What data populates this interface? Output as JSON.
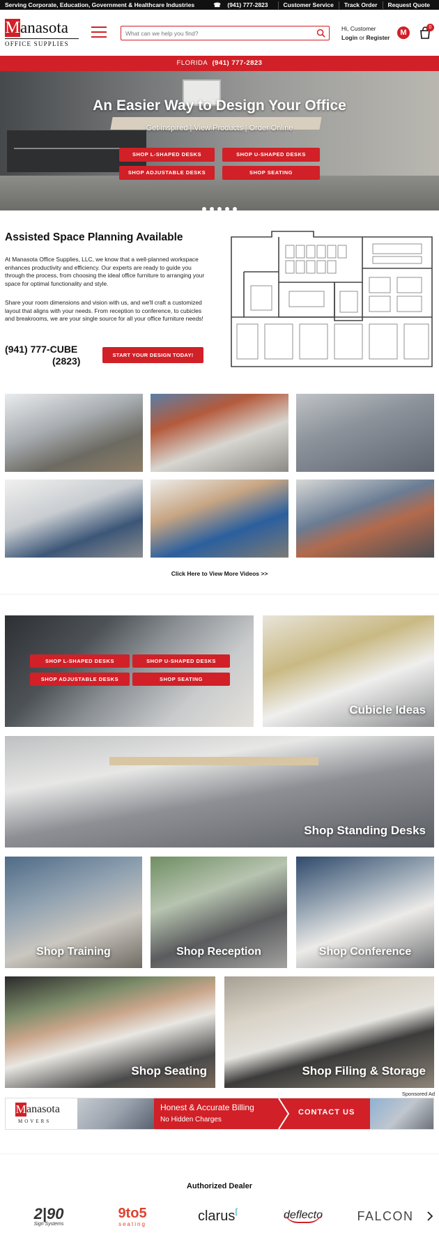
{
  "topbar": {
    "serving": "Serving Corporate, Education, Government & Healthcare Industries",
    "phone": "(941) 777-2823",
    "links": [
      "Customer Service",
      "Track Order",
      "Request Quote"
    ]
  },
  "header": {
    "logo_letter": "M",
    "logo_name": "anasota",
    "logo_sub": "OFFICE SUPPLIES",
    "search_placeholder": "What can we help you find?",
    "greeting": "Hi, Customer",
    "login": "Login",
    "or": "or",
    "register": "Register",
    "wishlist_letter": "M",
    "cart_count": "0"
  },
  "redbar": {
    "state": "FLORIDA",
    "phone": "(941) 777-2823"
  },
  "hero": {
    "title": "An Easier Way to Design Your Office",
    "tagline": "Get Inspired | View Products | Order Online",
    "buttons": [
      "SHOP L-SHAPED DESKS",
      "SHOP U-SHAPED DESKS",
      "SHOP ADJUSTABLE DESKS",
      "SHOP SEATING"
    ],
    "slides": 5
  },
  "planning": {
    "title": "Assisted Space Planning Available",
    "para1": "At Manasota Office Supplies, LLC, we know that a well-planned workspace enhances productivity and efficiency. Our experts are ready to guide you through the process, from choosing the ideal office furniture to arranging your space for optimal functionality and style.",
    "para2": "Share your room dimensions and vision with us, and we'll craft a customized layout that aligns with your needs. From reception to conference, to cubicles and breakrooms, we are your single source for all your office furniture needs!",
    "phone_line1": "(941) 777-CUBE",
    "phone_line2": "(2823)",
    "cta": "START YOUR DESIGN TODAY!"
  },
  "videos": {
    "more_link": "Click Here to View More Videos >>"
  },
  "categories": {
    "feature_buttons": [
      "SHOP L-SHAPED DESKS",
      "SHOP U-SHAPED DESKS",
      "SHOP ADJUSTABLE DESKS",
      "SHOP SEATING"
    ],
    "cubicle": "Cubicle Ideas",
    "standing": "Shop Standing Desks",
    "training": "Shop Training",
    "reception": "Shop Reception",
    "conference": "Shop Conference",
    "seating": "Shop Seating",
    "filing": "Shop Filing & Storage"
  },
  "ad": {
    "sponsored": "Sponsored Ad",
    "movers_name": "anasota",
    "movers_sub": "MOVERS",
    "line1": "Honest & Accurate Billing",
    "line2": "No Hidden Charges",
    "cta": "CONTACT US"
  },
  "dealers": {
    "title": "Authorized Dealer",
    "brands": [
      "2|90",
      "Sign Systems",
      "9to5",
      "seating",
      "clarus",
      "deflecto",
      "FALCON"
    ]
  },
  "colors": {
    "brand_red": "#d12027"
  }
}
